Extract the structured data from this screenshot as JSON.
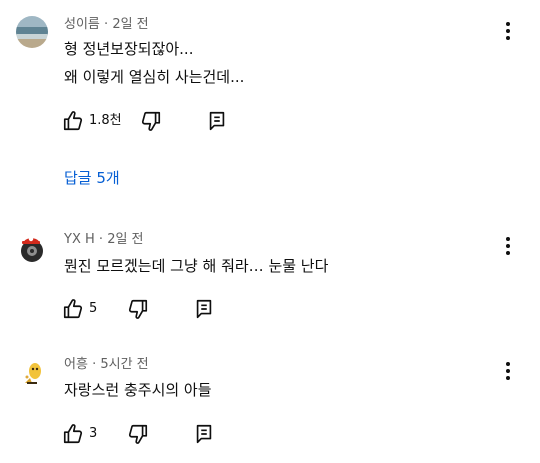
{
  "comments": [
    {
      "author": "성이름",
      "time": "2일 전",
      "separator": "·",
      "lines": [
        "형 정년보장되잖아...",
        "왜 이렇게 열심히 사는건데..."
      ],
      "likes": "1.8천",
      "avatar_icon": "ocean-landscape-avatar"
    },
    {
      "author": "YX H",
      "time": "2일 전",
      "separator": "·",
      "lines": [
        "뭔진 모르겠는데 그냥 해 줘라… 눈물 난다"
      ],
      "likes": "5",
      "avatar_icon": "mario-tire-avatar"
    },
    {
      "author": "어흥",
      "time": "5시간 전",
      "separator": "·",
      "lines": [
        "자랑스런 충주시의 아들"
      ],
      "likes": "3",
      "avatar_icon": "yellow-character-avatar"
    }
  ],
  "replies_label": "답글 5개",
  "colors": {
    "link": "#065fd4",
    "meta": "#606060",
    "text": "#0f0f0f"
  },
  "icons": {
    "like": "thumbs-up-icon",
    "dislike": "thumbs-down-icon",
    "reply": "reply-icon",
    "more": "more-vertical-icon"
  }
}
